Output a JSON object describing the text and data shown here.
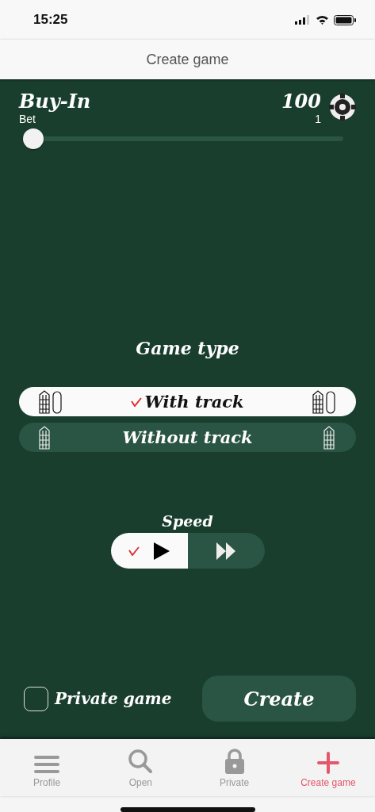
{
  "status_bar": {
    "time": "15:25"
  },
  "header": {
    "title": "Create game"
  },
  "buy_in": {
    "title": "Buy-In",
    "subtitle": "Bet",
    "value": "100",
    "reading": "1",
    "level": 0
  },
  "game_type": {
    "title": "Game type",
    "options": [
      {
        "label": "With track",
        "selected": true,
        "kind": "track"
      },
      {
        "label": "Without track",
        "selected": false,
        "kind": "board"
      }
    ]
  },
  "speed": {
    "title": "Speed",
    "options": [
      {
        "kind": "normal",
        "selected": true
      },
      {
        "kind": "fast",
        "selected": false
      }
    ]
  },
  "private_game": {
    "label": "Private game",
    "checked": false
  },
  "create_button": {
    "label": "Create"
  },
  "tab_bar": [
    {
      "label": "Profile",
      "kind": "menu",
      "selected": false
    },
    {
      "label": "Open",
      "kind": "search",
      "selected": false
    },
    {
      "label": "Private",
      "kind": "lock",
      "selected": false
    },
    {
      "label": "Create game",
      "kind": "plus",
      "selected": true
    }
  ]
}
